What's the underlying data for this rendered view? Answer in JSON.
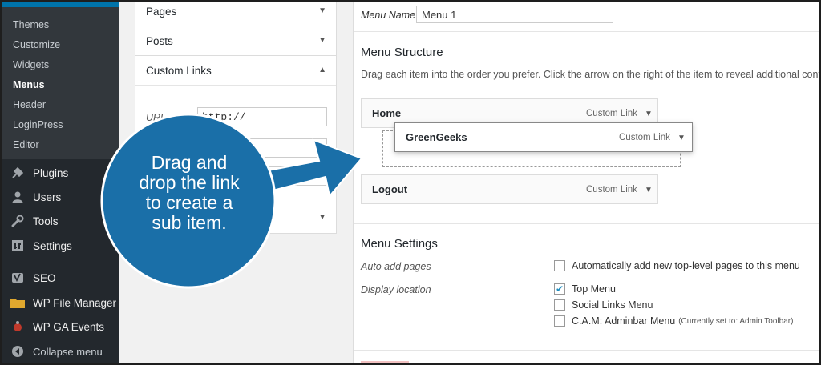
{
  "sidebar": {
    "submenu": [
      {
        "label": "Themes",
        "current": false
      },
      {
        "label": "Customize",
        "current": false
      },
      {
        "label": "Widgets",
        "current": false
      },
      {
        "label": "Menus",
        "current": true
      },
      {
        "label": "Header",
        "current": false
      },
      {
        "label": "LoginPress",
        "current": false
      },
      {
        "label": "Editor",
        "current": false
      }
    ],
    "items": [
      {
        "label": "Plugins",
        "icon": "plug-icon"
      },
      {
        "label": "Users",
        "icon": "user-icon"
      },
      {
        "label": "Tools",
        "icon": "wrench-icon"
      },
      {
        "label": "Settings",
        "icon": "settings-icon"
      },
      {
        "label": "SEO",
        "icon": "yoast-icon"
      },
      {
        "label": "WP File Manager",
        "icon": "folder-icon"
      },
      {
        "label": "WP GA Events",
        "icon": "ga-events-icon"
      }
    ],
    "collapse_label": "Collapse menu",
    "accent_color": "#0073aa"
  },
  "left_panel": {
    "pages_label": "Pages",
    "posts_label": "Posts",
    "custom_links_label": "Custom Links",
    "url_label": "URL",
    "url_value": "http://"
  },
  "right_panel": {
    "menu_name_label": "Menu Name",
    "menu_name_value": "Menu 1",
    "structure_title": "Menu Structure",
    "help_text": "Drag each item into the order you prefer. Click the arrow on the right of the item to reveal additional configurat",
    "items": [
      {
        "title": "Home",
        "type": "Custom Link"
      },
      {
        "title": "GreenGeeks",
        "type": "Custom Link"
      },
      {
        "title": "Logout",
        "type": "Custom Link"
      }
    ],
    "settings_title": "Menu Settings",
    "auto_add_label": "Auto add pages",
    "auto_add_option": "Automatically add new top-level pages to this menu",
    "display_location_label": "Display location",
    "locations": [
      {
        "label": "Top Menu",
        "checked": true,
        "note": ""
      },
      {
        "label": "Social Links Menu",
        "checked": false,
        "note": ""
      },
      {
        "label": "C.A.M: Adminbar Menu",
        "checked": false,
        "note": "(Currently set to: Admin Toolbar)"
      }
    ]
  },
  "callout": {
    "text_lines": [
      "Drag and",
      "drop the link",
      "to create a",
      "sub item."
    ],
    "color": "#1a6fa8"
  }
}
